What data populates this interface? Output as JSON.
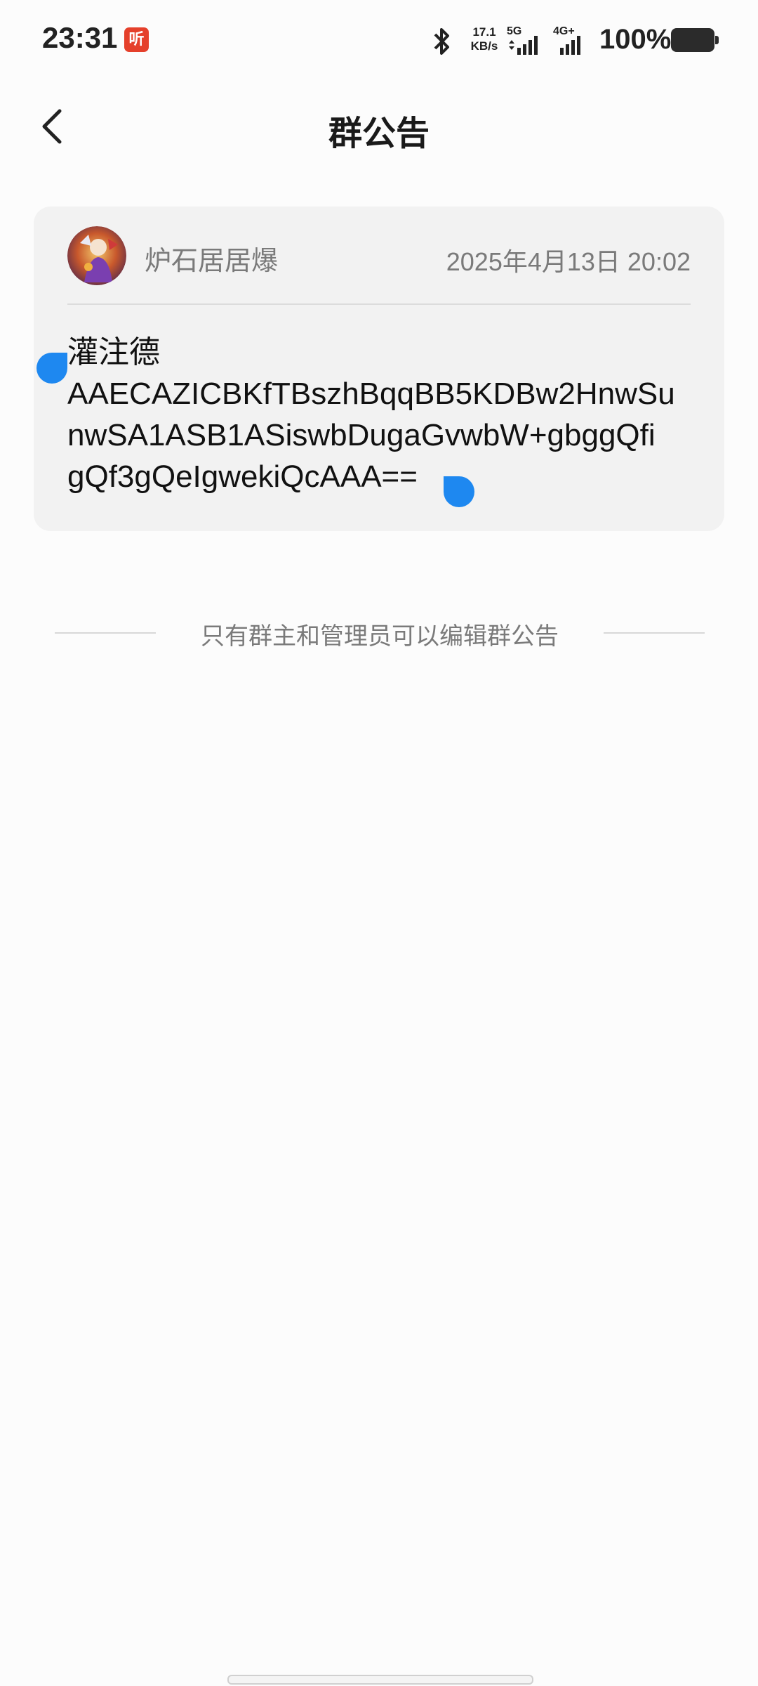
{
  "status_bar": {
    "time": "23:31",
    "app_badge": "听",
    "net_speed_value": "17.1",
    "net_speed_unit": "KB/s",
    "sim1_label": "5G",
    "sim2_label": "4G+",
    "battery": "100%",
    "icons": [
      "bluetooth-icon",
      "signal-5g-icon",
      "signal-4g-icon",
      "battery-icon"
    ]
  },
  "header": {
    "title": "群公告",
    "back_icon": "chevron-left-icon"
  },
  "announcement": {
    "author": "炉石居居爆",
    "time": "2025年4月13日 20:02",
    "body_lines": [
      "灌注德",
      "AAECAZICBKfTBszhBqqBB5KDBw2HnwSu",
      "nwSA1ASB1ASiswbDugaGvwbW+gbggQfi",
      "gQf3gQeIgwekiQcAAA=="
    ],
    "selection_color": "#1e88f0"
  },
  "footer_note": "只有群主和管理员可以编辑群公告",
  "colors": {
    "background": "#fcfcfc",
    "card": "#f2f2f2",
    "secondary_text": "#7a7a7a",
    "accent": "#1e88f0",
    "badge": "#e5402b"
  }
}
